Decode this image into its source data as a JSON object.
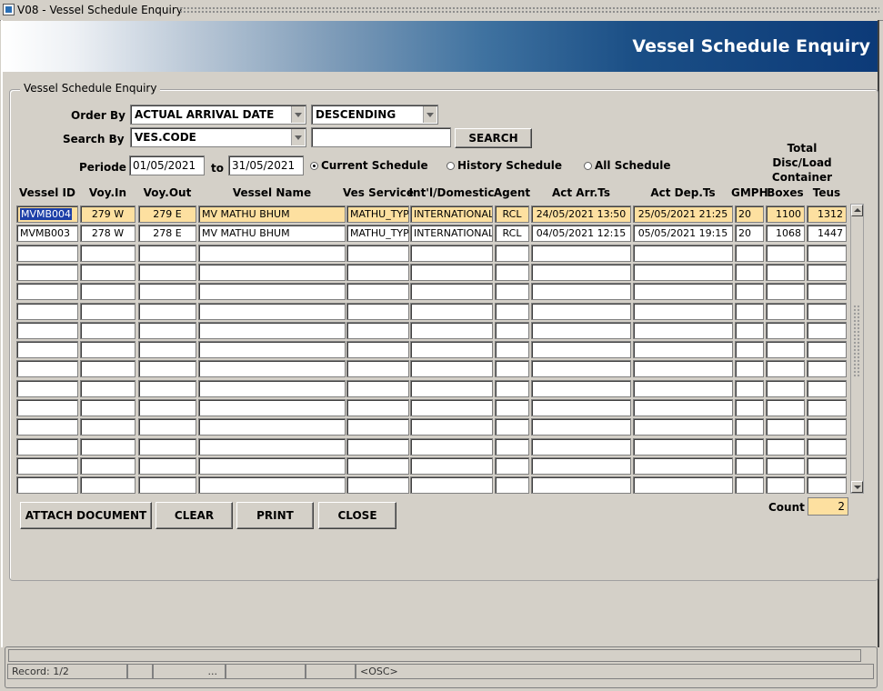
{
  "window": {
    "title": "V08 - Vessel Schedule Enquiry"
  },
  "banner": {
    "title": "Vessel Schedule Enquiry"
  },
  "form": {
    "group_label": "Vessel Schedule Enquiry",
    "order_by_label": "Order By",
    "order_by_value": "ACTUAL ARRIVAL DATE",
    "order_dir_value": "DESCENDING",
    "search_by_label": "Search By",
    "search_by_value": "VES.CODE",
    "search_text": "",
    "search_button": "SEARCH",
    "periode_label": "Periode",
    "date_from": "01/05/2021",
    "to_label": "to",
    "date_to": "31/05/2021",
    "radios": [
      {
        "label": "Current Schedule",
        "selected": true
      },
      {
        "label": "History Schedule",
        "selected": false
      },
      {
        "label": "All Schedule",
        "selected": false
      }
    ]
  },
  "table": {
    "total_header": "Total",
    "disc_load_header": "Disc/Load",
    "container_header": "Container",
    "columns": [
      "Vessel ID",
      "Voy.In",
      "Voy.Out",
      "Vessel Name",
      "Ves Service",
      "Int'l/Domestic",
      "Agent",
      "Act Arr.Ts",
      "Act Dep.Ts",
      "GMPH",
      "Boxes",
      "Teus"
    ],
    "rows": [
      [
        "MVMB004",
        "279 W",
        "279 E",
        "MV MATHU BHUM",
        "MATHU_TYPE",
        "INTERNATIONAL",
        "RCL",
        "24/05/2021 13:50",
        "25/05/2021 21:25",
        "20",
        "1100",
        "1312"
      ],
      [
        "MVMB003",
        "278 W",
        "278 E",
        "MV MATHU BHUM",
        "MATHU_TYPE",
        "INTERNATIONAL",
        "RCL",
        "04/05/2021 12:15",
        "05/05/2021 19:15",
        "20",
        "1068",
        "1447"
      ]
    ]
  },
  "buttons": {
    "attach": "ATTACH DOCUMENT",
    "clear": "CLEAR",
    "print": "PRINT",
    "close": "CLOSE"
  },
  "count": {
    "label": "Count",
    "value": "2"
  },
  "status": {
    "record": "Record: 1/2",
    "seg2": "",
    "seg3": "...",
    "seg4": "",
    "seg5": "",
    "osc": "<OSC>"
  },
  "colors": {
    "selected_row": "#fde0a0",
    "banner_dark": "#0c3a78",
    "focus": "#1c3fa8"
  },
  "icons": [
    "app-icon",
    "dropdown-arrow-icon",
    "scroll-up-icon",
    "scroll-down-icon"
  ]
}
